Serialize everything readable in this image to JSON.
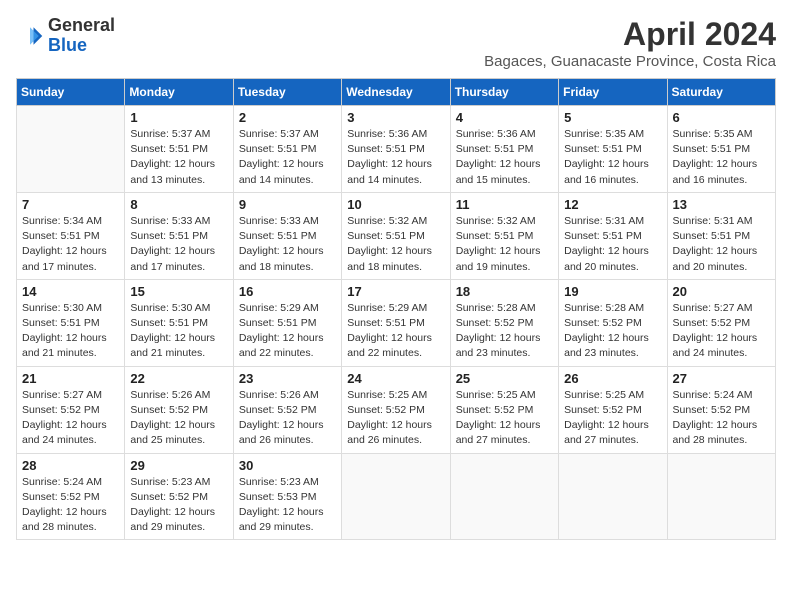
{
  "header": {
    "logo_line1": "General",
    "logo_line2": "Blue",
    "month_title": "April 2024",
    "subtitle": "Bagaces, Guanacaste Province, Costa Rica"
  },
  "weekdays": [
    "Sunday",
    "Monday",
    "Tuesday",
    "Wednesday",
    "Thursday",
    "Friday",
    "Saturday"
  ],
  "weeks": [
    [
      {
        "day": "",
        "sunrise": "",
        "sunset": "",
        "daylight": ""
      },
      {
        "day": "1",
        "sunrise": "5:37 AM",
        "sunset": "5:51 PM",
        "daylight": "12 hours and 13 minutes."
      },
      {
        "day": "2",
        "sunrise": "5:37 AM",
        "sunset": "5:51 PM",
        "daylight": "12 hours and 14 minutes."
      },
      {
        "day": "3",
        "sunrise": "5:36 AM",
        "sunset": "5:51 PM",
        "daylight": "12 hours and 14 minutes."
      },
      {
        "day": "4",
        "sunrise": "5:36 AM",
        "sunset": "5:51 PM",
        "daylight": "12 hours and 15 minutes."
      },
      {
        "day": "5",
        "sunrise": "5:35 AM",
        "sunset": "5:51 PM",
        "daylight": "12 hours and 16 minutes."
      },
      {
        "day": "6",
        "sunrise": "5:35 AM",
        "sunset": "5:51 PM",
        "daylight": "12 hours and 16 minutes."
      }
    ],
    [
      {
        "day": "7",
        "sunrise": "5:34 AM",
        "sunset": "5:51 PM",
        "daylight": "12 hours and 17 minutes."
      },
      {
        "day": "8",
        "sunrise": "5:33 AM",
        "sunset": "5:51 PM",
        "daylight": "12 hours and 17 minutes."
      },
      {
        "day": "9",
        "sunrise": "5:33 AM",
        "sunset": "5:51 PM",
        "daylight": "12 hours and 18 minutes."
      },
      {
        "day": "10",
        "sunrise": "5:32 AM",
        "sunset": "5:51 PM",
        "daylight": "12 hours and 18 minutes."
      },
      {
        "day": "11",
        "sunrise": "5:32 AM",
        "sunset": "5:51 PM",
        "daylight": "12 hours and 19 minutes."
      },
      {
        "day": "12",
        "sunrise": "5:31 AM",
        "sunset": "5:51 PM",
        "daylight": "12 hours and 20 minutes."
      },
      {
        "day": "13",
        "sunrise": "5:31 AM",
        "sunset": "5:51 PM",
        "daylight": "12 hours and 20 minutes."
      }
    ],
    [
      {
        "day": "14",
        "sunrise": "5:30 AM",
        "sunset": "5:51 PM",
        "daylight": "12 hours and 21 minutes."
      },
      {
        "day": "15",
        "sunrise": "5:30 AM",
        "sunset": "5:51 PM",
        "daylight": "12 hours and 21 minutes."
      },
      {
        "day": "16",
        "sunrise": "5:29 AM",
        "sunset": "5:51 PM",
        "daylight": "12 hours and 22 minutes."
      },
      {
        "day": "17",
        "sunrise": "5:29 AM",
        "sunset": "5:51 PM",
        "daylight": "12 hours and 22 minutes."
      },
      {
        "day": "18",
        "sunrise": "5:28 AM",
        "sunset": "5:52 PM",
        "daylight": "12 hours and 23 minutes."
      },
      {
        "day": "19",
        "sunrise": "5:28 AM",
        "sunset": "5:52 PM",
        "daylight": "12 hours and 23 minutes."
      },
      {
        "day": "20",
        "sunrise": "5:27 AM",
        "sunset": "5:52 PM",
        "daylight": "12 hours and 24 minutes."
      }
    ],
    [
      {
        "day": "21",
        "sunrise": "5:27 AM",
        "sunset": "5:52 PM",
        "daylight": "12 hours and 24 minutes."
      },
      {
        "day": "22",
        "sunrise": "5:26 AM",
        "sunset": "5:52 PM",
        "daylight": "12 hours and 25 minutes."
      },
      {
        "day": "23",
        "sunrise": "5:26 AM",
        "sunset": "5:52 PM",
        "daylight": "12 hours and 26 minutes."
      },
      {
        "day": "24",
        "sunrise": "5:25 AM",
        "sunset": "5:52 PM",
        "daylight": "12 hours and 26 minutes."
      },
      {
        "day": "25",
        "sunrise": "5:25 AM",
        "sunset": "5:52 PM",
        "daylight": "12 hours and 27 minutes."
      },
      {
        "day": "26",
        "sunrise": "5:25 AM",
        "sunset": "5:52 PM",
        "daylight": "12 hours and 27 minutes."
      },
      {
        "day": "27",
        "sunrise": "5:24 AM",
        "sunset": "5:52 PM",
        "daylight": "12 hours and 28 minutes."
      }
    ],
    [
      {
        "day": "28",
        "sunrise": "5:24 AM",
        "sunset": "5:52 PM",
        "daylight": "12 hours and 28 minutes."
      },
      {
        "day": "29",
        "sunrise": "5:23 AM",
        "sunset": "5:52 PM",
        "daylight": "12 hours and 29 minutes."
      },
      {
        "day": "30",
        "sunrise": "5:23 AM",
        "sunset": "5:53 PM",
        "daylight": "12 hours and 29 minutes."
      },
      {
        "day": "",
        "sunrise": "",
        "sunset": "",
        "daylight": ""
      },
      {
        "day": "",
        "sunrise": "",
        "sunset": "",
        "daylight": ""
      },
      {
        "day": "",
        "sunrise": "",
        "sunset": "",
        "daylight": ""
      },
      {
        "day": "",
        "sunrise": "",
        "sunset": "",
        "daylight": ""
      }
    ]
  ]
}
